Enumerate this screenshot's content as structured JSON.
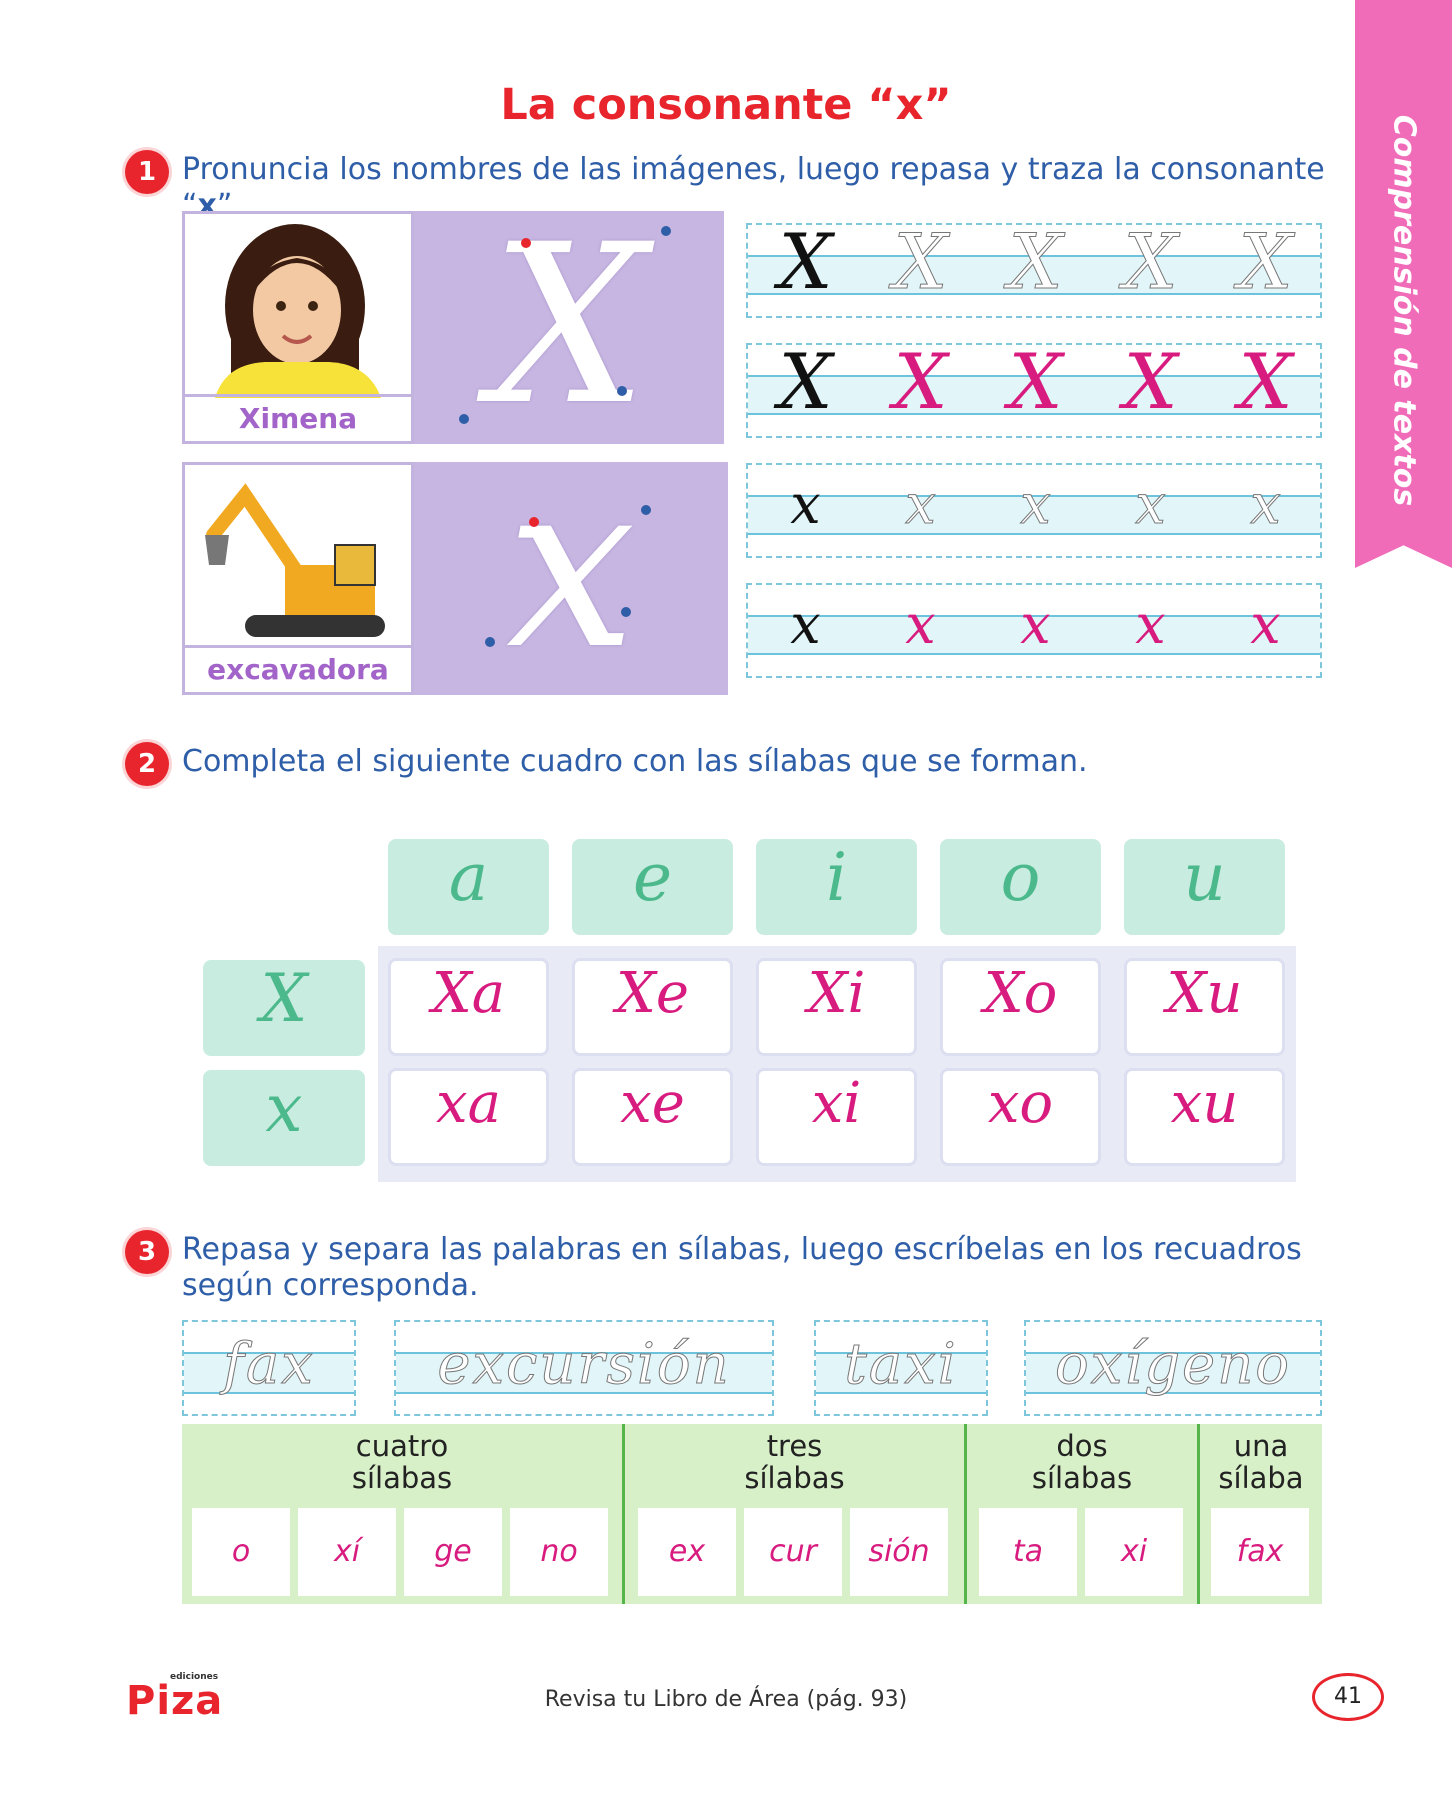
{
  "title": "La consonante “x”",
  "side_tab": "Comprensión de textos",
  "activities": {
    "a1": {
      "number": "1",
      "text_before": "Pronuncia los nombres de las imágenes, luego repasa y traza la consonante “",
      "letter": "x",
      "text_after": "”."
    },
    "a2": {
      "number": "2",
      "text": "Completa el siguiente cuadro con las sílabas que se forman."
    },
    "a3": {
      "number": "3",
      "text": "Repasa y separa las palabras en sílabas, luego escríbelas en los recuadros según corresponda."
    }
  },
  "pictures": [
    {
      "label": "Ximena",
      "letter": "X"
    },
    {
      "label": "excavadora",
      "letter": "x"
    }
  ],
  "trace_rows": [
    {
      "letters": [
        "X",
        "X",
        "X",
        "X",
        "X"
      ]
    },
    {
      "letters": [
        "X",
        "X",
        "X",
        "X",
        "X"
      ]
    },
    {
      "letters": [
        "x",
        "x",
        "x",
        "x",
        "x"
      ]
    },
    {
      "letters": [
        "x",
        "x",
        "x",
        "x",
        "x"
      ]
    }
  ],
  "syllable_grid": {
    "vowels": [
      "a",
      "e",
      "i",
      "o",
      "u"
    ],
    "rows": [
      {
        "consonant": "X",
        "syllables": [
          "Xa",
          "Xe",
          "Xi",
          "Xo",
          "Xu"
        ]
      },
      {
        "consonant": "x",
        "syllables": [
          "xa",
          "xe",
          "xi",
          "xo",
          "xu"
        ]
      }
    ]
  },
  "trace_words": [
    "fax",
    "excursión",
    "taxi",
    "oxígeno"
  ],
  "syllable_table": {
    "groups": [
      {
        "heading": "cuatro\nsílabas",
        "syllables": [
          "o",
          "xí",
          "ge",
          "no"
        ]
      },
      {
        "heading": "tres\nsílabas",
        "syllables": [
          "ex",
          "cur",
          "sión"
        ]
      },
      {
        "heading": "dos\nsílabas",
        "syllables": [
          "ta",
          "xi"
        ]
      },
      {
        "heading": "una\nsílaba",
        "syllables": [
          "fax"
        ]
      }
    ]
  },
  "footer": {
    "publisher_small": "ediciones",
    "publisher": "Piza",
    "note": "Revisa tu Libro de Área (pág. 93)",
    "page": "41"
  }
}
